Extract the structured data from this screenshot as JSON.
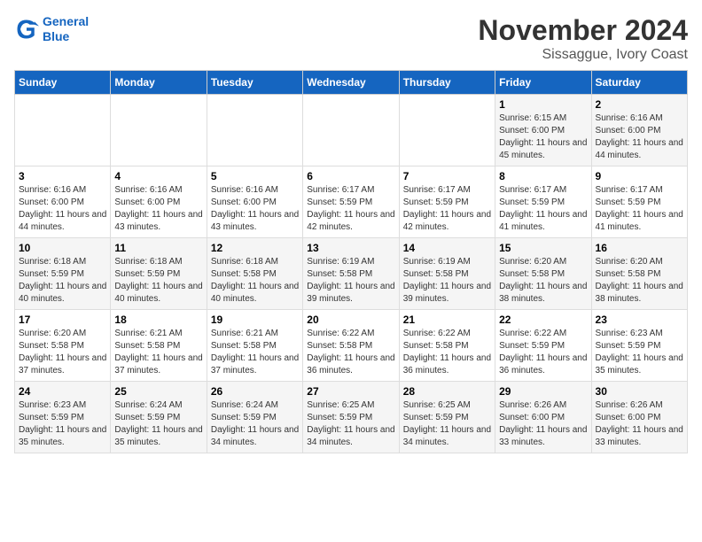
{
  "logo": {
    "line1": "General",
    "line2": "Blue"
  },
  "title": "November 2024",
  "subtitle": "Sissaggue, Ivory Coast",
  "days_of_week": [
    "Sunday",
    "Monday",
    "Tuesday",
    "Wednesday",
    "Thursday",
    "Friday",
    "Saturday"
  ],
  "weeks": [
    [
      {
        "day": "",
        "info": ""
      },
      {
        "day": "",
        "info": ""
      },
      {
        "day": "",
        "info": ""
      },
      {
        "day": "",
        "info": ""
      },
      {
        "day": "",
        "info": ""
      },
      {
        "day": "1",
        "info": "Sunrise: 6:15 AM\nSunset: 6:00 PM\nDaylight: 11 hours and 45 minutes."
      },
      {
        "day": "2",
        "info": "Sunrise: 6:16 AM\nSunset: 6:00 PM\nDaylight: 11 hours and 44 minutes."
      }
    ],
    [
      {
        "day": "3",
        "info": "Sunrise: 6:16 AM\nSunset: 6:00 PM\nDaylight: 11 hours and 44 minutes."
      },
      {
        "day": "4",
        "info": "Sunrise: 6:16 AM\nSunset: 6:00 PM\nDaylight: 11 hours and 43 minutes."
      },
      {
        "day": "5",
        "info": "Sunrise: 6:16 AM\nSunset: 6:00 PM\nDaylight: 11 hours and 43 minutes."
      },
      {
        "day": "6",
        "info": "Sunrise: 6:17 AM\nSunset: 5:59 PM\nDaylight: 11 hours and 42 minutes."
      },
      {
        "day": "7",
        "info": "Sunrise: 6:17 AM\nSunset: 5:59 PM\nDaylight: 11 hours and 42 minutes."
      },
      {
        "day": "8",
        "info": "Sunrise: 6:17 AM\nSunset: 5:59 PM\nDaylight: 11 hours and 41 minutes."
      },
      {
        "day": "9",
        "info": "Sunrise: 6:17 AM\nSunset: 5:59 PM\nDaylight: 11 hours and 41 minutes."
      }
    ],
    [
      {
        "day": "10",
        "info": "Sunrise: 6:18 AM\nSunset: 5:59 PM\nDaylight: 11 hours and 40 minutes."
      },
      {
        "day": "11",
        "info": "Sunrise: 6:18 AM\nSunset: 5:59 PM\nDaylight: 11 hours and 40 minutes."
      },
      {
        "day": "12",
        "info": "Sunrise: 6:18 AM\nSunset: 5:58 PM\nDaylight: 11 hours and 40 minutes."
      },
      {
        "day": "13",
        "info": "Sunrise: 6:19 AM\nSunset: 5:58 PM\nDaylight: 11 hours and 39 minutes."
      },
      {
        "day": "14",
        "info": "Sunrise: 6:19 AM\nSunset: 5:58 PM\nDaylight: 11 hours and 39 minutes."
      },
      {
        "day": "15",
        "info": "Sunrise: 6:20 AM\nSunset: 5:58 PM\nDaylight: 11 hours and 38 minutes."
      },
      {
        "day": "16",
        "info": "Sunrise: 6:20 AM\nSunset: 5:58 PM\nDaylight: 11 hours and 38 minutes."
      }
    ],
    [
      {
        "day": "17",
        "info": "Sunrise: 6:20 AM\nSunset: 5:58 PM\nDaylight: 11 hours and 37 minutes."
      },
      {
        "day": "18",
        "info": "Sunrise: 6:21 AM\nSunset: 5:58 PM\nDaylight: 11 hours and 37 minutes."
      },
      {
        "day": "19",
        "info": "Sunrise: 6:21 AM\nSunset: 5:58 PM\nDaylight: 11 hours and 37 minutes."
      },
      {
        "day": "20",
        "info": "Sunrise: 6:22 AM\nSunset: 5:58 PM\nDaylight: 11 hours and 36 minutes."
      },
      {
        "day": "21",
        "info": "Sunrise: 6:22 AM\nSunset: 5:58 PM\nDaylight: 11 hours and 36 minutes."
      },
      {
        "day": "22",
        "info": "Sunrise: 6:22 AM\nSunset: 5:59 PM\nDaylight: 11 hours and 36 minutes."
      },
      {
        "day": "23",
        "info": "Sunrise: 6:23 AM\nSunset: 5:59 PM\nDaylight: 11 hours and 35 minutes."
      }
    ],
    [
      {
        "day": "24",
        "info": "Sunrise: 6:23 AM\nSunset: 5:59 PM\nDaylight: 11 hours and 35 minutes."
      },
      {
        "day": "25",
        "info": "Sunrise: 6:24 AM\nSunset: 5:59 PM\nDaylight: 11 hours and 35 minutes."
      },
      {
        "day": "26",
        "info": "Sunrise: 6:24 AM\nSunset: 5:59 PM\nDaylight: 11 hours and 34 minutes."
      },
      {
        "day": "27",
        "info": "Sunrise: 6:25 AM\nSunset: 5:59 PM\nDaylight: 11 hours and 34 minutes."
      },
      {
        "day": "28",
        "info": "Sunrise: 6:25 AM\nSunset: 5:59 PM\nDaylight: 11 hours and 34 minutes."
      },
      {
        "day": "29",
        "info": "Sunrise: 6:26 AM\nSunset: 6:00 PM\nDaylight: 11 hours and 33 minutes."
      },
      {
        "day": "30",
        "info": "Sunrise: 6:26 AM\nSunset: 6:00 PM\nDaylight: 11 hours and 33 minutes."
      }
    ]
  ]
}
